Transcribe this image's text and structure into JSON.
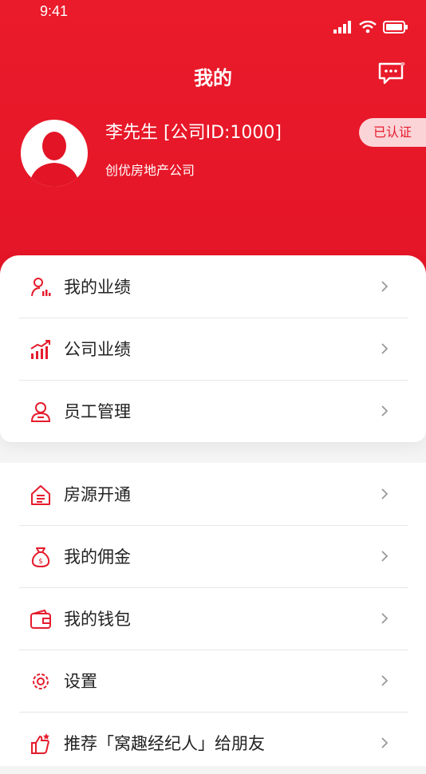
{
  "status": {
    "time": "9:41"
  },
  "header": {
    "title": "我的"
  },
  "profile": {
    "name": "李先生 [公司ID:1000]",
    "company": "创优房地产公司",
    "badge": "已认证"
  },
  "menu_primary": [
    {
      "label": "我的业绩",
      "icon": "person-chart-icon"
    },
    {
      "label": "公司业绩",
      "icon": "bar-growth-icon"
    },
    {
      "label": "员工管理",
      "icon": "staff-icon"
    }
  ],
  "menu_secondary": [
    {
      "label": "房源开通",
      "icon": "house-list-icon"
    },
    {
      "label": "我的佣金",
      "icon": "money-bag-icon"
    },
    {
      "label": "我的钱包",
      "icon": "wallet-icon"
    },
    {
      "label": "设置",
      "icon": "gear-icon"
    },
    {
      "label": "推荐「窝趣经纪人」给朋友",
      "icon": "thumb-star-icon"
    }
  ],
  "colors": {
    "brand": "#e51c2c",
    "badge_bg": "#fbd4d8"
  }
}
